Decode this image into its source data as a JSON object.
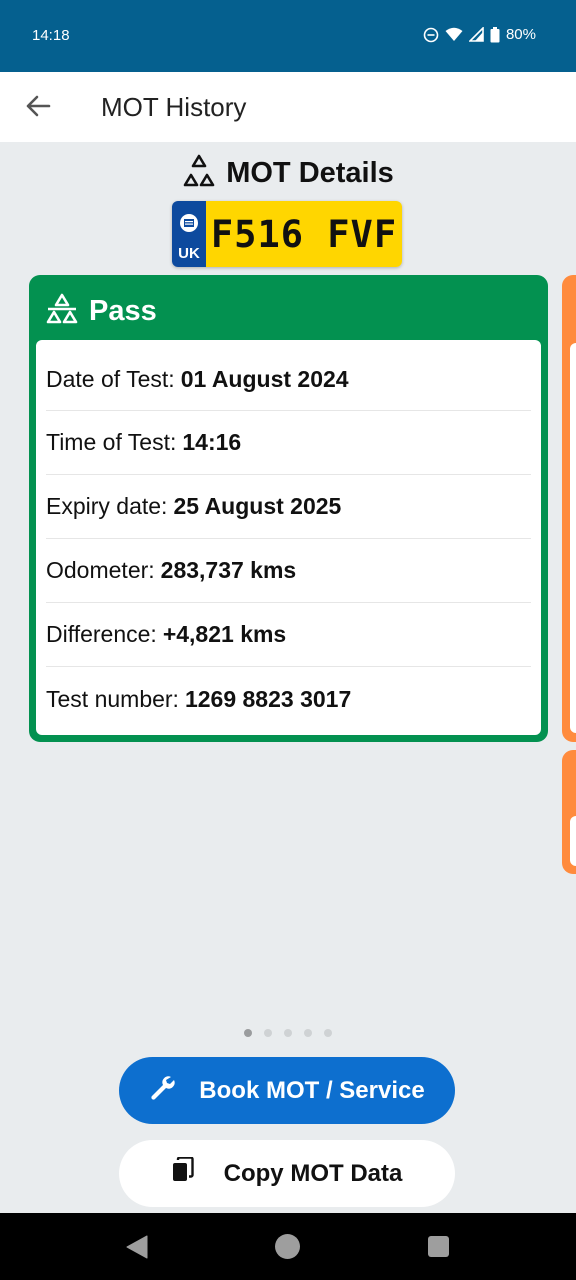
{
  "status_bar": {
    "time": "14:18",
    "battery": "80%"
  },
  "app_bar": {
    "title": "MOT History"
  },
  "details": {
    "title": "MOT Details"
  },
  "plate": {
    "country": "UK",
    "number": "F516 FVF"
  },
  "card": {
    "status": "Pass",
    "rows": [
      {
        "label": "Date of Test:",
        "value": "01 August 2024"
      },
      {
        "label": "Time of Test:",
        "value": "14:16"
      },
      {
        "label": "Expiry date:",
        "value": "25 August 2025"
      },
      {
        "label": "Odometer:",
        "value": "283,737 kms"
      },
      {
        "label": "Difference:",
        "value": "+4,821 kms"
      },
      {
        "label": "Test number:",
        "value": "1269 8823 3017"
      }
    ]
  },
  "pager": {
    "count": 5,
    "active_index": 0
  },
  "buttons": {
    "book": "Book MOT / Service",
    "copy": "Copy MOT Data"
  },
  "colors": {
    "pass": "#039150",
    "advisory": "#ff8b3d",
    "primary": "#0d6fcf",
    "plate_yellow": "#ffd600"
  }
}
